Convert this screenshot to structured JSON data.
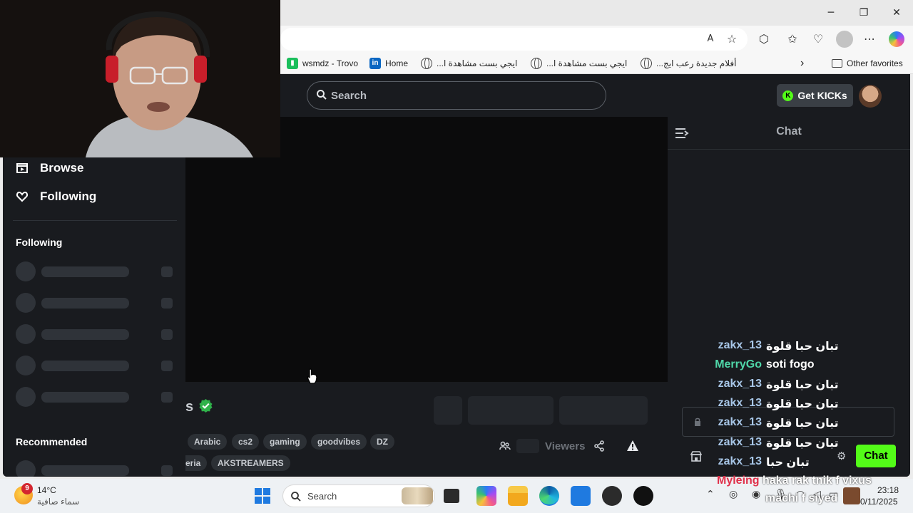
{
  "browser": {
    "window_controls": {
      "minimize": "─",
      "restore": "❐",
      "close": "✕"
    },
    "favorites": [
      {
        "label": "wsmdz - Trovo",
        "icon": "trovo-icon"
      },
      {
        "label": "Home",
        "icon": "linkedin-icon"
      },
      {
        "label": "ايجي بست مشاهدة ا...",
        "icon": "globe-icon"
      },
      {
        "label": "ايجي بست مشاهدة ا...",
        "icon": "globe-icon"
      },
      {
        "label": "أفلام جديدة رعب ايج...",
        "icon": "globe-icon"
      }
    ],
    "other_favorites": "Other favorites"
  },
  "kick": {
    "search_placeholder": "Search",
    "get_kicks": "Get KICKs",
    "nav": {
      "browse": "Browse",
      "following": "Following"
    },
    "sections": {
      "following": "Following",
      "recommended": "Recommended"
    },
    "streamer_name_fragment": "s",
    "tags": [
      "Arabic",
      "cs2",
      "gaming",
      "goodvibes",
      "DZ",
      "eria",
      "AKSTREAMERS"
    ],
    "viewers_label": "Viewers",
    "chat": {
      "title": "Chat",
      "send_button": "Chat",
      "messages": [
        {
          "user": "zakx_13",
          "text": "تبان حبا قلوة",
          "color": "#a8c7e8"
        },
        {
          "user": "MerryGo",
          "text": "soti fogo",
          "color": "#4fd6a8"
        },
        {
          "user": "zakx_13",
          "text": "تبان حبا قلوة",
          "color": "#a8c7e8"
        },
        {
          "user": "zakx_13",
          "text": "تبان حبا قلوة",
          "color": "#a8c7e8"
        },
        {
          "user": "zakx_13",
          "text": "تبان حبا قلوة",
          "color": "#a8c7e8"
        },
        {
          "user": "zakx_13",
          "text": "تبان حبا قلوة",
          "color": "#a8c7e8"
        },
        {
          "user": "zakx_13",
          "text": "تبان حبا",
          "color": "#a8c7e8"
        }
      ],
      "overflow_line": {
        "user": "Myleing",
        "text": "haka rak tnik f vixus",
        "color": "#e0304a"
      },
      "overflow_line2": "machi f siyed"
    }
  },
  "taskbar": {
    "weather_temp": "14°C",
    "weather_desc": "سماء صافية",
    "weather_badge": "9",
    "search": "Search",
    "time": "23:18",
    "date": "0/11/2025"
  },
  "colors": {
    "kick_green": "#53fc18",
    "page_bg": "#191b1f"
  }
}
